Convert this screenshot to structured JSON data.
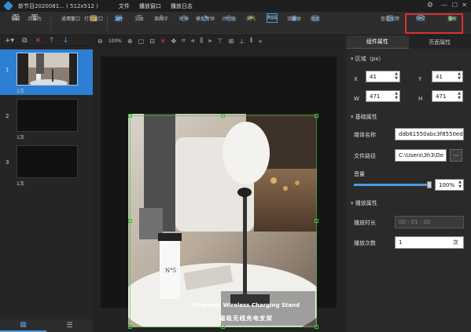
{
  "titlebar": {
    "title": "新节目2020081... ( 512x512 )",
    "menus": [
      "文件",
      "播放窗口",
      "播放日志"
    ]
  },
  "toolbar": {
    "tools": [
      {
        "label": "保存",
        "icon": "save-icon"
      },
      {
        "label": "另存为",
        "icon": "save-as-icon"
      },
      {
        "label": "通用窗口",
        "icon": "window-icon"
      },
      {
        "label": "打折窗口",
        "icon": "split-window-icon"
      },
      {
        "label": "文件",
        "icon": "folder-icon"
      },
      {
        "label": "文本",
        "icon": "text-icon"
      },
      {
        "label": "滚动字",
        "icon": "scroll-text-icon"
      },
      {
        "label": "时钟",
        "icon": "clock-icon"
      },
      {
        "label": "模拟时钟",
        "icon": "analog-clock-icon"
      },
      {
        "label": "计时器",
        "icon": "timer-icon"
      },
      {
        "label": "天气",
        "icon": "weather-icon"
      },
      {
        "label": "RSS",
        "icon": "rss-icon"
      },
      {
        "label": "流媒体",
        "icon": "stream-icon"
      },
      {
        "label": "网页",
        "icon": "web-icon"
      }
    ],
    "right_tools": [
      {
        "label": "查看故障",
        "icon": "fault-icon"
      },
      {
        "label": "预览",
        "icon": "preview-icon"
      },
      {
        "label": "播放",
        "icon": "play-icon"
      }
    ]
  },
  "canvas_toolbar": {
    "zoom": "100%"
  },
  "scenes": [
    {
      "number": "1",
      "count": "1次",
      "selected": true
    },
    {
      "number": "2",
      "count": "1次",
      "selected": false
    },
    {
      "number": "3",
      "count": "1次",
      "selected": false
    }
  ],
  "media": {
    "caption_en": "Magnetic Wireless Charging Stand",
    "caption_cn": "磁吸无线充电支架",
    "cup_text": "N°5"
  },
  "right_panel": {
    "tabs": [
      "组件属性",
      "页面属性"
    ],
    "region": {
      "title": "区域（px）",
      "x_label": "X",
      "x": "41",
      "y_label": "Y",
      "y": "41",
      "w_label": "W",
      "w": "471",
      "h_label": "H",
      "h": "471"
    },
    "basic": {
      "title": "基础属性",
      "media_name_label": "媒体名称",
      "media_name": "ddb61550abc3f8550ed5",
      "file_path_label": "文件路径",
      "file_path": "C:\\Users\\3h3\\De",
      "browse_label": "···",
      "volume_label": "音量",
      "volume_value": "100%",
      "volume_level": 1.0
    },
    "playback": {
      "title": "播放属性",
      "duration_label": "播放时长",
      "duration": "00 : 01 : 00",
      "times_label": "播放次数",
      "times": "1",
      "times_unit": "次"
    }
  }
}
